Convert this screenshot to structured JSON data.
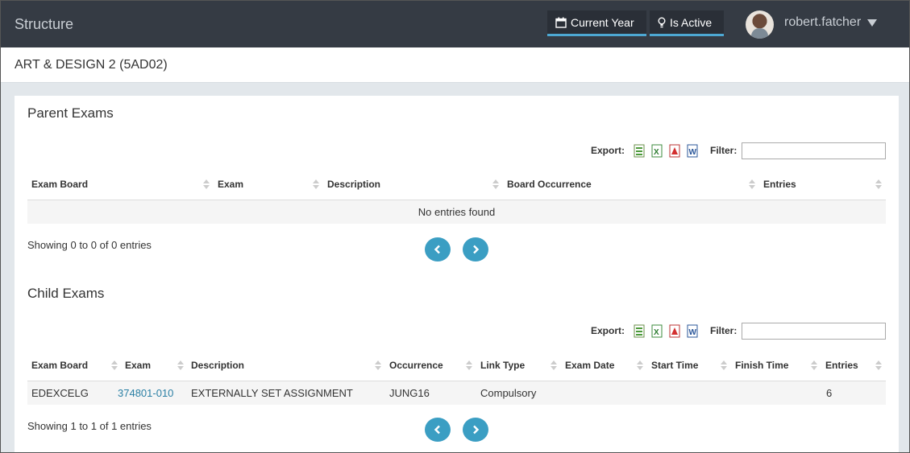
{
  "header": {
    "brand": "Structure",
    "current_year": "Current Year",
    "is_active": "Is Active",
    "username": "robert.fatcher"
  },
  "page": {
    "title": "ART & DESIGN 2 (5AD02)"
  },
  "parent": {
    "title": "Parent Exams",
    "export_label": "Export:",
    "filter_label": "Filter:",
    "filter_value": "",
    "columns": [
      "Exam Board",
      "Exam",
      "Description",
      "Board Occurrence",
      "Entries"
    ],
    "empty_text": "No entries found",
    "info": "Showing 0 to 0 of 0 entries"
  },
  "child": {
    "title": "Child Exams",
    "export_label": "Export:",
    "filter_label": "Filter:",
    "filter_value": "",
    "columns": [
      "Exam Board",
      "Exam",
      "Description",
      "Occurrence",
      "Link Type",
      "Exam Date",
      "Start Time",
      "Finish Time",
      "Entries"
    ],
    "rows": [
      [
        "EDEXCELG",
        "374801-010",
        "EXTERNALLY SET ASSIGNMENT",
        "JUNG16",
        "Compulsory",
        "",
        "",
        "",
        "6"
      ]
    ],
    "info": "Showing 1 to 1 of 1 entries"
  },
  "icons": {
    "calendar": "calendar-icon",
    "bulb": "lightbulb-icon",
    "export": [
      "csv-export-icon",
      "excel-export-icon",
      "pdf-export-icon",
      "word-export-icon"
    ],
    "prev": "chevron-left-icon",
    "next": "chevron-right-icon"
  },
  "colors": {
    "topbar": "#353b44",
    "accent": "#4da8d3",
    "pager": "#3b9ec3",
    "link": "#2a7fa4"
  }
}
